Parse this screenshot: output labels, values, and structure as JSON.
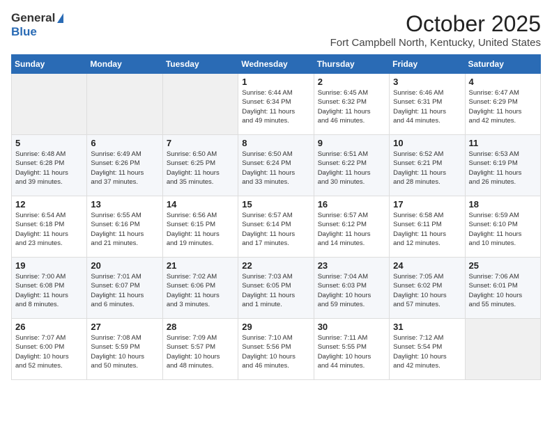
{
  "header": {
    "logo_general": "General",
    "logo_blue": "Blue",
    "month_title": "October 2025",
    "location": "Fort Campbell North, Kentucky, United States"
  },
  "calendar": {
    "days_of_week": [
      "Sunday",
      "Monday",
      "Tuesday",
      "Wednesday",
      "Thursday",
      "Friday",
      "Saturday"
    ],
    "weeks": [
      [
        {
          "day": "",
          "info": ""
        },
        {
          "day": "",
          "info": ""
        },
        {
          "day": "",
          "info": ""
        },
        {
          "day": "1",
          "info": "Sunrise: 6:44 AM\nSunset: 6:34 PM\nDaylight: 11 hours\nand 49 minutes."
        },
        {
          "day": "2",
          "info": "Sunrise: 6:45 AM\nSunset: 6:32 PM\nDaylight: 11 hours\nand 46 minutes."
        },
        {
          "day": "3",
          "info": "Sunrise: 6:46 AM\nSunset: 6:31 PM\nDaylight: 11 hours\nand 44 minutes."
        },
        {
          "day": "4",
          "info": "Sunrise: 6:47 AM\nSunset: 6:29 PM\nDaylight: 11 hours\nand 42 minutes."
        }
      ],
      [
        {
          "day": "5",
          "info": "Sunrise: 6:48 AM\nSunset: 6:28 PM\nDaylight: 11 hours\nand 39 minutes."
        },
        {
          "day": "6",
          "info": "Sunrise: 6:49 AM\nSunset: 6:26 PM\nDaylight: 11 hours\nand 37 minutes."
        },
        {
          "day": "7",
          "info": "Sunrise: 6:50 AM\nSunset: 6:25 PM\nDaylight: 11 hours\nand 35 minutes."
        },
        {
          "day": "8",
          "info": "Sunrise: 6:50 AM\nSunset: 6:24 PM\nDaylight: 11 hours\nand 33 minutes."
        },
        {
          "day": "9",
          "info": "Sunrise: 6:51 AM\nSunset: 6:22 PM\nDaylight: 11 hours\nand 30 minutes."
        },
        {
          "day": "10",
          "info": "Sunrise: 6:52 AM\nSunset: 6:21 PM\nDaylight: 11 hours\nand 28 minutes."
        },
        {
          "day": "11",
          "info": "Sunrise: 6:53 AM\nSunset: 6:19 PM\nDaylight: 11 hours\nand 26 minutes."
        }
      ],
      [
        {
          "day": "12",
          "info": "Sunrise: 6:54 AM\nSunset: 6:18 PM\nDaylight: 11 hours\nand 23 minutes."
        },
        {
          "day": "13",
          "info": "Sunrise: 6:55 AM\nSunset: 6:16 PM\nDaylight: 11 hours\nand 21 minutes."
        },
        {
          "day": "14",
          "info": "Sunrise: 6:56 AM\nSunset: 6:15 PM\nDaylight: 11 hours\nand 19 minutes."
        },
        {
          "day": "15",
          "info": "Sunrise: 6:57 AM\nSunset: 6:14 PM\nDaylight: 11 hours\nand 17 minutes."
        },
        {
          "day": "16",
          "info": "Sunrise: 6:57 AM\nSunset: 6:12 PM\nDaylight: 11 hours\nand 14 minutes."
        },
        {
          "day": "17",
          "info": "Sunrise: 6:58 AM\nSunset: 6:11 PM\nDaylight: 11 hours\nand 12 minutes."
        },
        {
          "day": "18",
          "info": "Sunrise: 6:59 AM\nSunset: 6:10 PM\nDaylight: 11 hours\nand 10 minutes."
        }
      ],
      [
        {
          "day": "19",
          "info": "Sunrise: 7:00 AM\nSunset: 6:08 PM\nDaylight: 11 hours\nand 8 minutes."
        },
        {
          "day": "20",
          "info": "Sunrise: 7:01 AM\nSunset: 6:07 PM\nDaylight: 11 hours\nand 6 minutes."
        },
        {
          "day": "21",
          "info": "Sunrise: 7:02 AM\nSunset: 6:06 PM\nDaylight: 11 hours\nand 3 minutes."
        },
        {
          "day": "22",
          "info": "Sunrise: 7:03 AM\nSunset: 6:05 PM\nDaylight: 11 hours\nand 1 minute."
        },
        {
          "day": "23",
          "info": "Sunrise: 7:04 AM\nSunset: 6:03 PM\nDaylight: 10 hours\nand 59 minutes."
        },
        {
          "day": "24",
          "info": "Sunrise: 7:05 AM\nSunset: 6:02 PM\nDaylight: 10 hours\nand 57 minutes."
        },
        {
          "day": "25",
          "info": "Sunrise: 7:06 AM\nSunset: 6:01 PM\nDaylight: 10 hours\nand 55 minutes."
        }
      ],
      [
        {
          "day": "26",
          "info": "Sunrise: 7:07 AM\nSunset: 6:00 PM\nDaylight: 10 hours\nand 52 minutes."
        },
        {
          "day": "27",
          "info": "Sunrise: 7:08 AM\nSunset: 5:59 PM\nDaylight: 10 hours\nand 50 minutes."
        },
        {
          "day": "28",
          "info": "Sunrise: 7:09 AM\nSunset: 5:57 PM\nDaylight: 10 hours\nand 48 minutes."
        },
        {
          "day": "29",
          "info": "Sunrise: 7:10 AM\nSunset: 5:56 PM\nDaylight: 10 hours\nand 46 minutes."
        },
        {
          "day": "30",
          "info": "Sunrise: 7:11 AM\nSunset: 5:55 PM\nDaylight: 10 hours\nand 44 minutes."
        },
        {
          "day": "31",
          "info": "Sunrise: 7:12 AM\nSunset: 5:54 PM\nDaylight: 10 hours\nand 42 minutes."
        },
        {
          "day": "",
          "info": ""
        }
      ]
    ]
  }
}
